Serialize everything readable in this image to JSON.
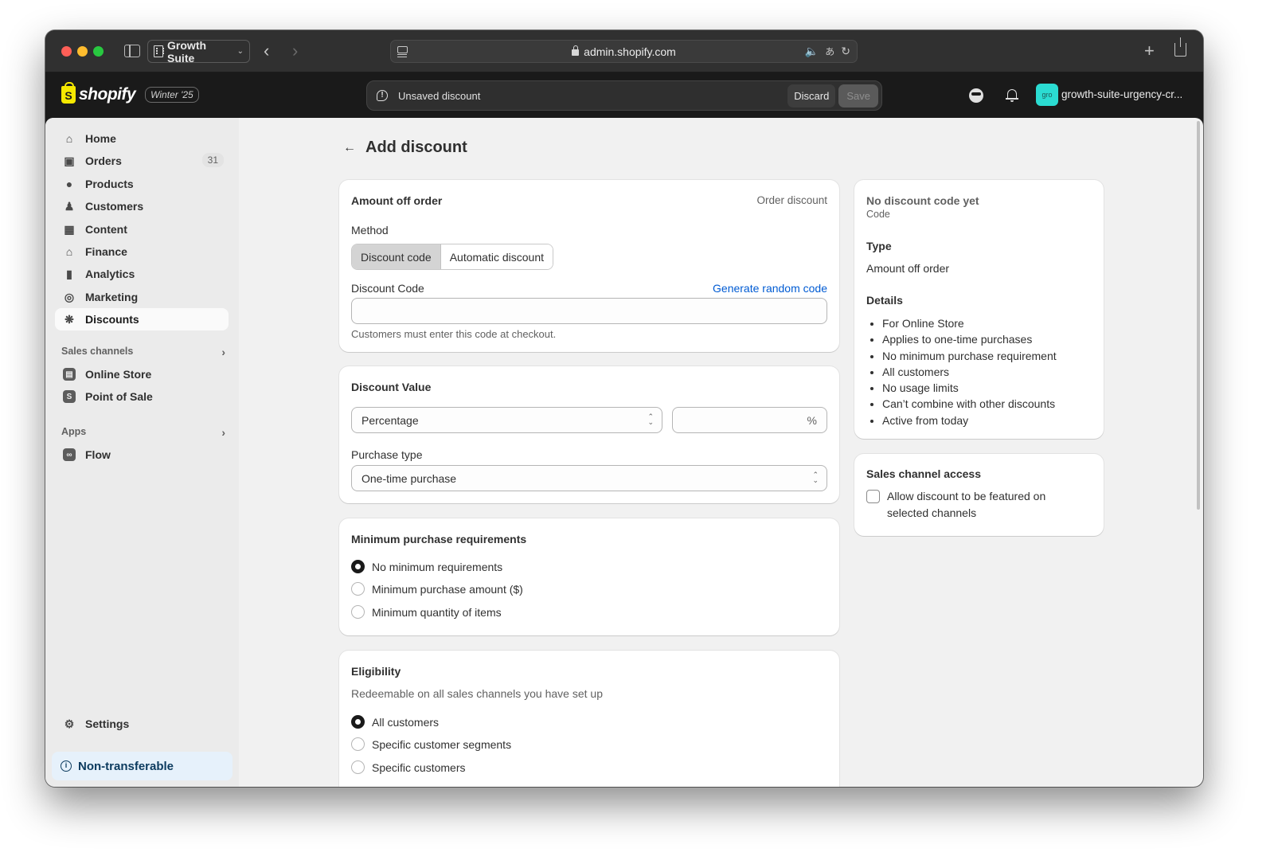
{
  "browser": {
    "profile_name": "Growth Suite",
    "url": "admin.shopify.com"
  },
  "topbar": {
    "logo_text": "shopify",
    "edition_badge": "Winter '25",
    "unsaved_text": "Unsaved discount",
    "discard_label": "Discard",
    "save_label": "Save",
    "store_avatar": "gro",
    "store_name": "growth-suite-urgency-cr..."
  },
  "sidebar": {
    "items": [
      {
        "label": "Home",
        "icon": "home-icon"
      },
      {
        "label": "Orders",
        "icon": "inbox-icon",
        "badge": "31"
      },
      {
        "label": "Products",
        "icon": "tag-icon"
      },
      {
        "label": "Customers",
        "icon": "person-icon"
      },
      {
        "label": "Content",
        "icon": "image-icon"
      },
      {
        "label": "Finance",
        "icon": "bank-icon"
      },
      {
        "label": "Analytics",
        "icon": "bar-chart-icon"
      },
      {
        "label": "Marketing",
        "icon": "target-icon"
      },
      {
        "label": "Discounts",
        "icon": "discount-icon",
        "active": true
      }
    ],
    "sales_channels_label": "Sales channels",
    "sales_channels": [
      {
        "label": "Online Store",
        "icon": "store-icon"
      },
      {
        "label": "Point of Sale",
        "icon": "pos-icon"
      }
    ],
    "apps_label": "Apps",
    "apps": [
      {
        "label": "Flow",
        "icon": "flow-icon"
      }
    ],
    "settings_label": "Settings",
    "non_transferable_label": "Non-transferable"
  },
  "main": {
    "page_title": "Add discount",
    "amount_card": {
      "title": "Amount off order",
      "type_label": "Order discount",
      "method_label": "Method",
      "method_options": [
        "Discount code",
        "Automatic discount"
      ],
      "method_selected": "Discount code",
      "code_label": "Discount Code",
      "generate_link": "Generate random code",
      "code_value": "",
      "code_help": "Customers must enter this code at checkout."
    },
    "value_card": {
      "title": "Discount Value",
      "value_type": "Percentage",
      "value_amount": "",
      "value_suffix": "%",
      "purchase_type_label": "Purchase type",
      "purchase_type": "One-time purchase"
    },
    "min_card": {
      "title": "Minimum purchase requirements",
      "options": [
        "No minimum requirements",
        "Minimum purchase amount ($)",
        "Minimum quantity of items"
      ],
      "selected": 0
    },
    "eligibility_card": {
      "title": "Eligibility",
      "subtitle": "Redeemable on all sales channels you have set up",
      "options": [
        "All customers",
        "Specific customer segments",
        "Specific customers"
      ],
      "selected": 0
    }
  },
  "summary": {
    "code_title": "No discount code yet",
    "code_sub": "Code",
    "type_title": "Type",
    "type_value": "Amount off order",
    "details_title": "Details",
    "details": [
      "For Online Store",
      "Applies to one-time purchases",
      "No minimum purchase requirement",
      "All customers",
      "No usage limits",
      "Can’t combine with other discounts",
      "Active from today"
    ],
    "channel_title": "Sales channel access",
    "channel_checkbox_label": "Allow discount to be featured on selected channels",
    "channel_checked": false
  }
}
